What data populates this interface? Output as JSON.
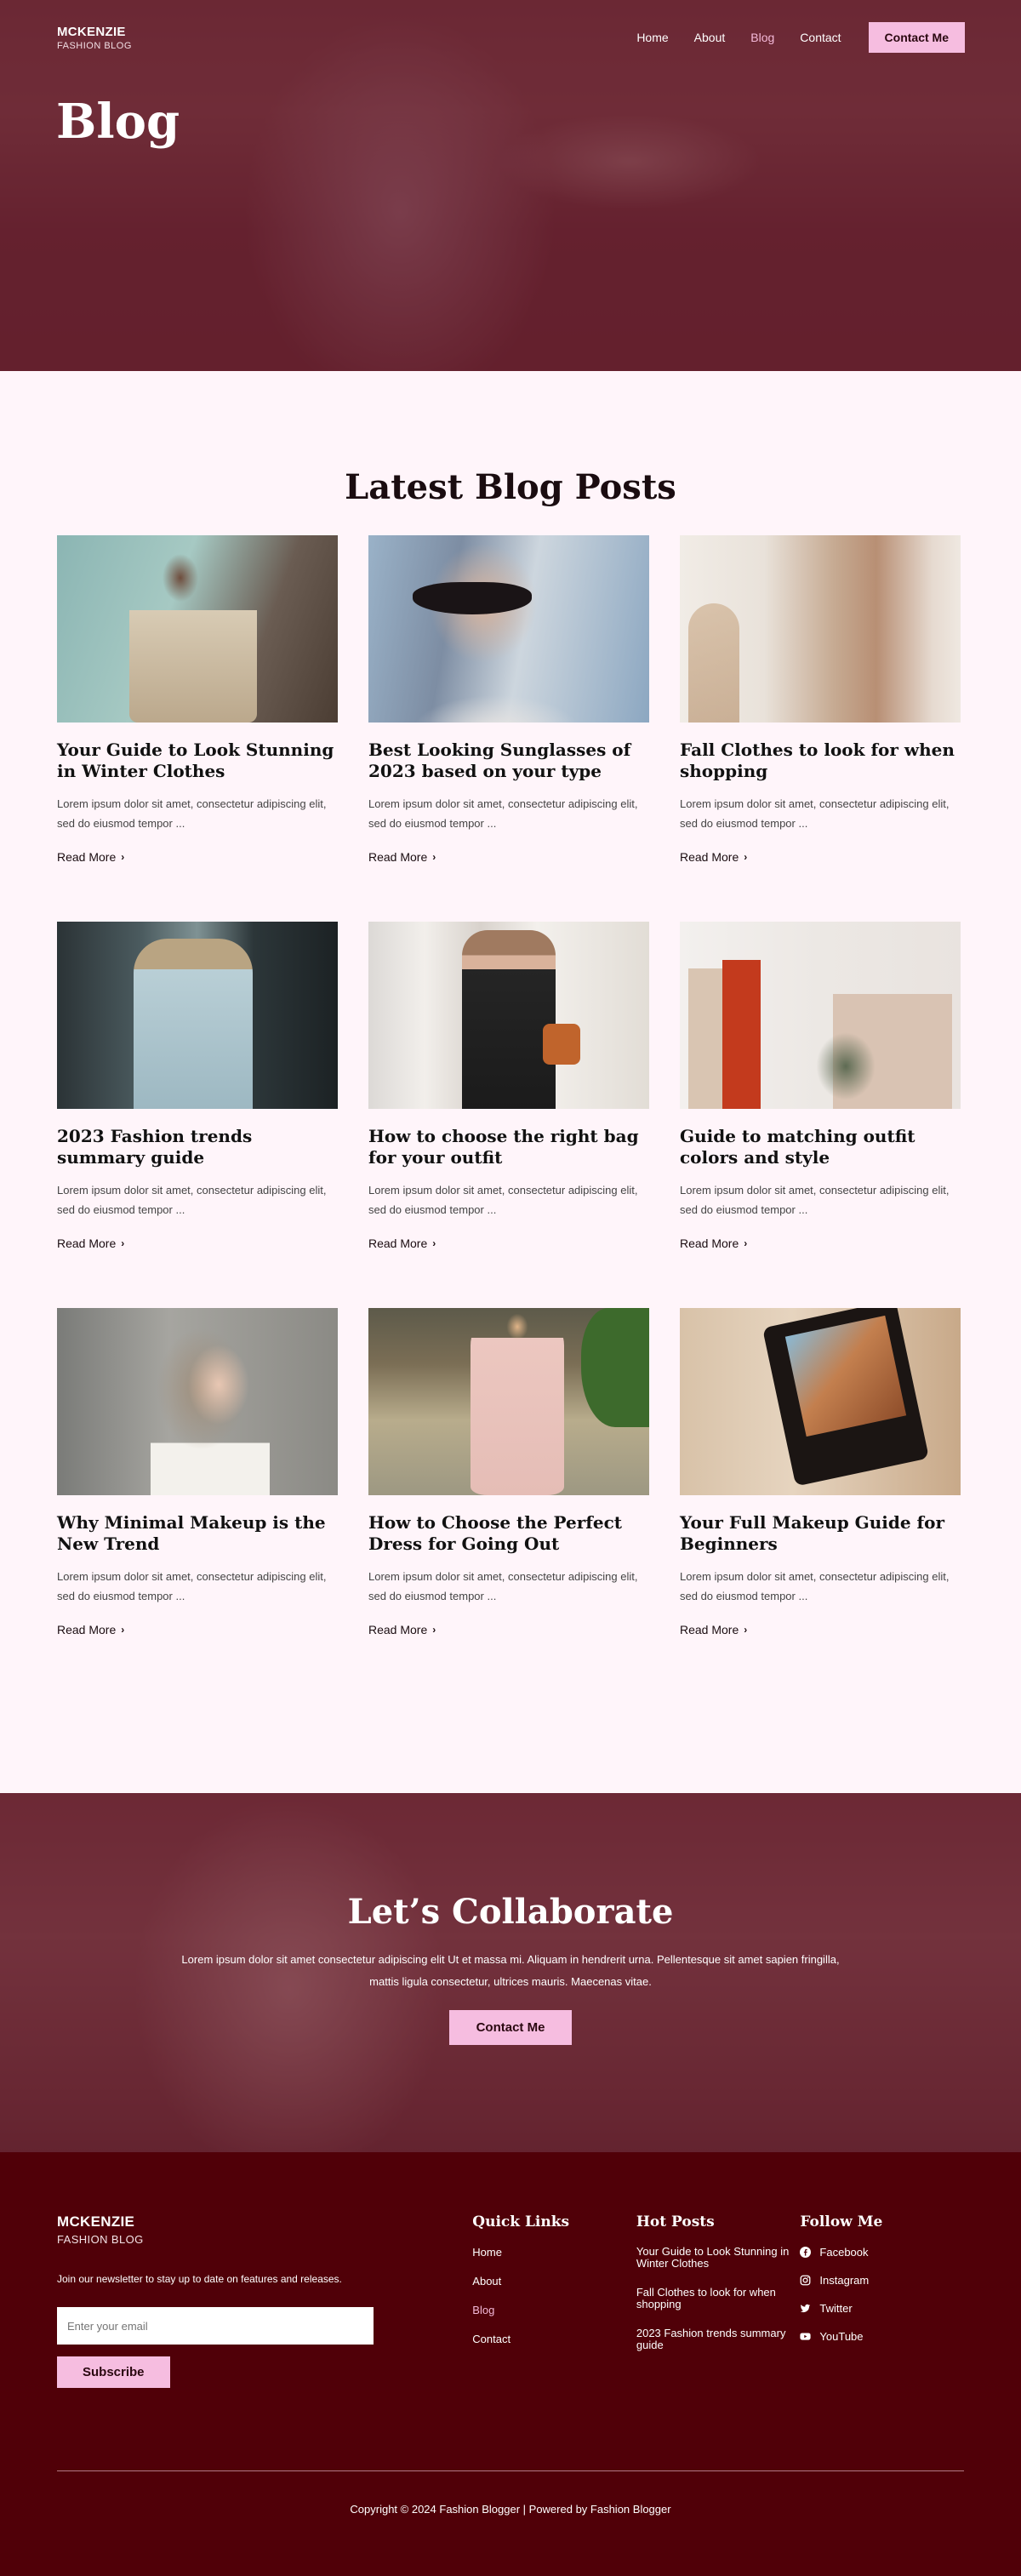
{
  "brand": {
    "name": "MCKENZIE",
    "tagline": "FASHION BLOG"
  },
  "nav": {
    "links": [
      {
        "label": "Home",
        "active": false
      },
      {
        "label": "About",
        "active": false
      },
      {
        "label": "Blog",
        "active": true
      },
      {
        "label": "Contact",
        "active": false
      }
    ],
    "cta": "Contact Me"
  },
  "hero": {
    "title": "Blog"
  },
  "blog": {
    "heading": "Latest Blog Posts",
    "read_more": "Read More",
    "posts": [
      {
        "title": "Your Guide to Look Stunning in Winter Clothes",
        "excerpt": "Lorem ipsum dolor sit amet, consectetur adipiscing elit, sed do eiusmod tempor ..."
      },
      {
        "title": "Best Looking Sunglasses of 2023 based on your type",
        "excerpt": "Lorem ipsum dolor sit amet, consectetur adipiscing elit, sed do eiusmod tempor ..."
      },
      {
        "title": "Fall Clothes to look for when shopping",
        "excerpt": "Lorem ipsum dolor sit amet, consectetur adipiscing elit, sed do eiusmod tempor ..."
      },
      {
        "title": "2023 Fashion trends summary guide",
        "excerpt": "Lorem ipsum dolor sit amet, consectetur adipiscing elit, sed do eiusmod tempor ..."
      },
      {
        "title": "How to choose the right bag for your outfit",
        "excerpt": "Lorem ipsum dolor sit amet, consectetur adipiscing elit, sed do eiusmod tempor ..."
      },
      {
        "title": "Guide to matching outfit colors and style",
        "excerpt": "Lorem ipsum dolor sit amet, consectetur adipiscing elit, sed do eiusmod tempor ..."
      },
      {
        "title": "Why Minimal Makeup is the New Trend",
        "excerpt": "Lorem ipsum dolor sit amet, consectetur adipiscing elit, sed do eiusmod tempor ..."
      },
      {
        "title": "How to Choose the Perfect Dress for Going Out",
        "excerpt": "Lorem ipsum dolor sit amet, consectetur adipiscing elit, sed do eiusmod tempor ..."
      },
      {
        "title": "Your Full Makeup Guide for Beginners",
        "excerpt": "Lorem ipsum dolor sit amet, consectetur adipiscing elit, sed do eiusmod tempor ..."
      }
    ]
  },
  "collab": {
    "title": "Let’s Collaborate",
    "text": "Lorem ipsum dolor sit amet consectetur adipiscing elit Ut et massa mi. Aliquam in hendrerit urna. Pellentesque sit amet sapien fringilla, mattis ligula consectetur, ultrices mauris. Maecenas vitae.",
    "cta": "Contact Me"
  },
  "footer": {
    "newsletter_text": "Join our newsletter to stay up to date on features and releases.",
    "email_placeholder": "Enter your email",
    "subscribe": "Subscribe",
    "quick_links": {
      "title": "Quick Links",
      "items": [
        {
          "label": "Home",
          "active": false
        },
        {
          "label": "About",
          "active": false
        },
        {
          "label": "Blog",
          "active": true
        },
        {
          "label": "Contact",
          "active": false
        }
      ]
    },
    "hot_posts": {
      "title": "Hot Posts",
      "items": [
        "Your Guide to Look Stunning in Winter Clothes",
        "Fall Clothes to look for when shopping",
        "2023 Fashion trends summary guide"
      ]
    },
    "follow": {
      "title": "Follow Me",
      "items": [
        {
          "label": "Facebook",
          "icon": "facebook-icon"
        },
        {
          "label": "Instagram",
          "icon": "instagram-icon"
        },
        {
          "label": "Twitter",
          "icon": "twitter-icon"
        },
        {
          "label": "YouTube",
          "icon": "youtube-icon"
        }
      ]
    },
    "copyright": "Copyright © 2024 Fashion Blogger | Powered by Fashion Blogger"
  },
  "colors": {
    "page_bg": "#fff5fa",
    "accent_pink": "#f6bde0",
    "footer_bg": "#500008",
    "active_link": "#f4b9d9"
  }
}
